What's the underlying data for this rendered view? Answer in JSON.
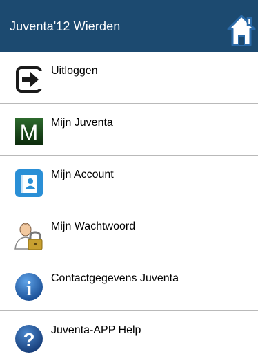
{
  "header": {
    "title": "Juventa'12 Wierden",
    "home_icon": "home-icon",
    "background": "#1c4a70"
  },
  "menu": {
    "items": [
      {
        "label": "Uitloggen",
        "icon": "logout-icon"
      },
      {
        "label": "Mijn Juventa",
        "icon": "juventa-m-icon",
        "icon_text": "M"
      },
      {
        "label": "Mijn Account",
        "icon": "account-icon"
      },
      {
        "label": "Mijn Wachtwoord",
        "icon": "user-lock-icon"
      },
      {
        "label": "Contactgegevens Juventa",
        "icon": "info-icon",
        "icon_text": "i"
      },
      {
        "label": "Juventa-APP Help",
        "icon": "help-icon",
        "icon_text": "?"
      }
    ]
  }
}
